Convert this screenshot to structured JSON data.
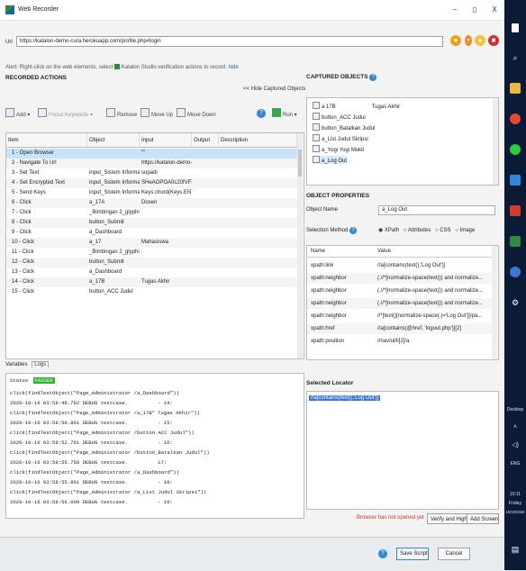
{
  "window": {
    "title": "Web Recorder",
    "controls": [
      "–",
      "▯",
      "X"
    ]
  },
  "url": {
    "label": "Url",
    "value": "https://katalon-demo-cura.herokuapp.com/profile.php#login"
  },
  "hint": {
    "text": "Alert: Right-click on the web elements, select",
    "brand": "Katalon Studio verification actions to record.",
    "link": "hide"
  },
  "recorded": {
    "title": "RECORDED ACTIONS",
    "hide_captured": "<< Hide Captured Objects",
    "toolbar": {
      "add": "Add",
      "focus": "Focus Keywords",
      "remove": "Remove",
      "move_up": "Move Up",
      "move_down": "Move Down",
      "run": "Run"
    },
    "columns": [
      "Item",
      "Object",
      "Input",
      "Output",
      "Description"
    ],
    "rows": [
      {
        "item": "1 - Open Browser",
        "object": "",
        "input": "\"\"",
        "sel": true
      },
      {
        "item": "2 - Navigate To Url",
        "object": "",
        "input": "https://katalon-demo-cura"
      },
      {
        "item": "3 - Set Text",
        "object": "input_Sistem Informasi Tug",
        "input": "supadi"
      },
      {
        "item": "4 - Set Encrypted Text",
        "object": "input_Sistem Informasi Tug",
        "input": "SHeAOPOA0c20fVFaA4"
      },
      {
        "item": "5 - Send Keys",
        "object": "input_Sistem Informasi Tug",
        "input": "Keys.chord(Keys.ENTER)"
      },
      {
        "item": "6 - Click",
        "object": "a_17A",
        "input": "Dosen"
      },
      {
        "item": "7 - Click",
        "object": "_Bimbingan 2_glyphicon g",
        "input": ""
      },
      {
        "item": "8 - Click",
        "object": "button_Submit",
        "input": ""
      },
      {
        "item": "9 - Click",
        "object": "a_Dashboard",
        "input": ""
      },
      {
        "item": "10 - Click",
        "object": "a_17",
        "input": "Mahasiswa"
      },
      {
        "item": "11 - Click",
        "object": "_Bimbingan 2_glyphicon g",
        "input": ""
      },
      {
        "item": "12 - Click",
        "object": "button_Submit",
        "input": ""
      },
      {
        "item": "13 - Click",
        "object": "a_Dashboard",
        "input": ""
      },
      {
        "item": "14 - Click",
        "object": "a_17B",
        "input": "Tugas Akhir"
      },
      {
        "item": "15 - Click",
        "object": "button_ACC Judul",
        "input": ""
      }
    ]
  },
  "logs": {
    "tabs": [
      "Variables",
      "Logs"
    ],
    "status_label": "Status",
    "status_value": "PASSED",
    "lines": [
      {
        "text": "click(findTestObject(\"Page_Administrator /a_Dashboard\"))",
        "right": ""
      },
      {
        "text": "2020-10-16 03:58:48.792 DEBUG testcase.",
        "right": "- 14:"
      },
      {
        "text": "click(findTestObject(\"Page_Administrator /a_17B\"",
        "right": "Tugas Akhir\"))"
      },
      {
        "text": "2020-10-16 03:58:50.861 DEBUG testcase.",
        "right": "- 15:"
      },
      {
        "text": "click(findTestObject(\"Page_Administrator /button ACC Judul\"))",
        "right": ""
      },
      {
        "text": "2020-10-16 03:58:52.701 DEBUG testcase.",
        "right": "- 16:"
      },
      {
        "text": "click(findTestObject(\"Page_Administrator /button_Batalkan Judul\"))",
        "right": ""
      },
      {
        "text": "2020-10-16 03:58:55.750 DEBUG testcase.",
        "right": "17:"
      },
      {
        "text": "click(findTestObject(\"Page_Administrator /a_Dashboard\"))",
        "right": ""
      },
      {
        "text": "2020-10-16 03:58:55.891 DEBUG testcase.",
        "right": "- 18:"
      },
      {
        "text": "click(findTestObject(\"Page_Administrator /a_List Judul Skripsi\"))",
        "right": ""
      },
      {
        "text": "2020-10-16 03:58:56.000 DEBUG testcase.",
        "right": "- 19:"
      }
    ]
  },
  "captured": {
    "title": "CAPTURED OBJECTS",
    "items": [
      {
        "label": "a 17B",
        "extra": "Tugas Akhir"
      },
      {
        "label": "button_ACC Judul",
        "extra": ""
      },
      {
        "label": "button_Batalkan Judul",
        "extra": ""
      },
      {
        "label": "a_List Judul Skripsi",
        "extra": ""
      },
      {
        "label": "a_Yogi Yogi Mukti",
        "extra": ""
      },
      {
        "label": "a_Log Out",
        "extra": "",
        "sel": true
      }
    ]
  },
  "properties": {
    "title": "OBJECT PROPERTIES",
    "name_label": "Object Name",
    "name_value": "a_Log Out",
    "method_label": "Selection Method",
    "methods": [
      "XPath",
      "Attributes",
      "CSS",
      "Image"
    ],
    "columns": [
      "Name",
      "Value"
    ],
    "rows": [
      {
        "name": "xpath:link",
        "value": "//a[contains(text(),'Log Out')]"
      },
      {
        "name": "xpath:neighbor",
        "value": "(.//*[normalize-space(text()) and normalize..."
      },
      {
        "name": "xpath:neighbor",
        "value": "(.//*[normalize-space(text()) and normalize..."
      },
      {
        "name": "xpath:neighbor",
        "value": "(.//*[normalize-space(text()) and normalize..."
      },
      {
        "name": "xpath:neighbor",
        "value": "//*[text()[normalize-space(.)='Log Out']]/pa..."
      },
      {
        "name": "xpath:href",
        "value": "//a[contains(@href, 'logout.php')][2]"
      },
      {
        "name": "xpath:position",
        "value": "//nav/ul/li[2]/a"
      }
    ]
  },
  "locator": {
    "title": "Selected Locator",
    "value": "//a[contains(text(),'Log Out')]"
  },
  "actions": {
    "warning": "Browser has not opened yet",
    "verify": "Verify and Highlight",
    "add_screenshot": "Add Screenshot",
    "save": "Save Script",
    "cancel": "Cancel"
  },
  "taskbar": {
    "desktop": "Desktop",
    "lang": "ENG",
    "time": "10:11",
    "day": "Friday",
    "date": "16/10/2020"
  },
  "colors": {
    "passed": "#32b332",
    "selection": "#3a78d6",
    "taskbar": "#0b1b36"
  }
}
